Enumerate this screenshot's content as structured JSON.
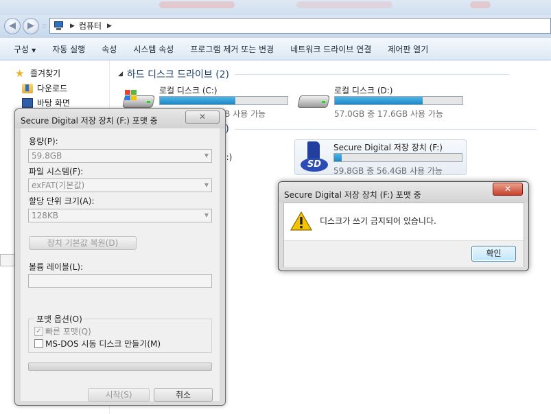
{
  "address": {
    "path": "컴퓨터"
  },
  "toolbar": {
    "organize": "구성",
    "autoplay": "자동 실행",
    "properties": "속성",
    "system_properties": "시스템 속성",
    "uninstall": "프로그램 제거 또는 변경",
    "map_drive": "네트워크 드라이브 연결",
    "control_panel": "제어판 열기"
  },
  "navpane": {
    "favorites": "즐겨찾기",
    "downloads": "다운로드",
    "desktop": "바탕 화면"
  },
  "hdd_group": {
    "title": "하드 디스크 드라이브 (2)"
  },
  "removable_group": {
    "count": "(2)"
  },
  "drives": [
    {
      "name": "로컬 디스크 (C:)",
      "info": "119GB 중 49.4GB 사용 가능",
      "used_fraction": 0.59
    },
    {
      "name": "로컬 디스크 (D:)",
      "info": "57.0GB 중 17.6GB 사용 가능",
      "used_fraction": 0.69
    },
    {
      "name": "Secure Digital 저장 장치 (F:)",
      "info": "59.8GB 중 56.4GB 사용 가능",
      "used_fraction": 0.06
    }
  ],
  "partial_drive": {
    "label": "E:)"
  },
  "format_dialog": {
    "title": "Secure Digital 저장 장치 (F:) 포맷 중",
    "capacity_label": "용량(P):",
    "capacity_value": "59.8GB",
    "fs_label": "파일 시스템(F):",
    "fs_value": "exFAT(기본값)",
    "alloc_label": "할당 단위 크기(A):",
    "alloc_value": "128KB",
    "restore_defaults": "장치 기본값 복원(D)",
    "volume_label": "볼륨 레이블(L):",
    "volume_value": "",
    "options_label": "포맷 옵션(O)",
    "quick_format": "빠른 포맷(Q)",
    "quick_format_checked": true,
    "msdos_boot": "MS-DOS 시동 디스크 만들기(M)",
    "msdos_boot_checked": false,
    "progress": 0,
    "start": "시작(S)",
    "cancel": "취소"
  },
  "message_box": {
    "title": "Secure Digital 저장 장치 (F:) 포맷 중",
    "message": "디스크가 쓰기 금지되어 있습니다.",
    "ok": "확인"
  },
  "colors": {
    "progress_fill": "#1f86c6",
    "ok_border": "#3c7fb1",
    "close_red": "#c7422a",
    "warning_yellow": "#f5c400"
  }
}
